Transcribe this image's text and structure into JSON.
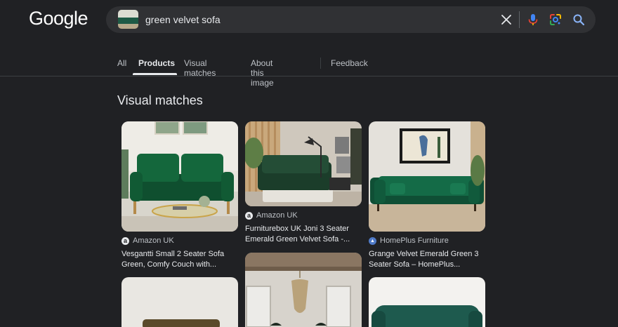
{
  "logo": "Google",
  "search": {
    "query": "green velvet sofa"
  },
  "tabs": [
    {
      "label": "All"
    },
    {
      "label": "Products"
    },
    {
      "label": "Visual matches"
    },
    {
      "label": "About this image"
    },
    {
      "label": "Feedback"
    }
  ],
  "section_title": "Visual matches",
  "results": [
    {
      "source": "Amazon UK",
      "title_lines": [
        "Vesgantti Small 2 Seater Sofa",
        "Green, Comfy Couch with..."
      ]
    },
    {
      "source": "Amazon UK",
      "title_lines": [
        "Furniturebox UK Joni 3 Seater",
        "Emerald Green Velvet Sofa -..."
      ]
    },
    {
      "source": "HomePlus Furniture",
      "title_lines": [
        "Grange Velvet Emerald Green 3",
        "Seater Sofa – HomePlus..."
      ]
    }
  ],
  "colors": {
    "background": "#202124",
    "search_bg": "#303134",
    "accent_blue": "#8ab4f8"
  },
  "icons": [
    "clear-icon",
    "voice-search-icon",
    "lens-icon",
    "search-icon",
    "amazon-favicon",
    "homeplus-favicon"
  ]
}
